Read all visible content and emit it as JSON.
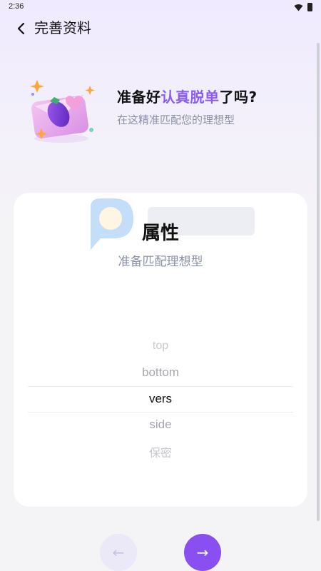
{
  "status": {
    "time": "2:36"
  },
  "header": {
    "title": "完善资料"
  },
  "hero": {
    "title_before": "准备好",
    "title_accent": "认真脱单",
    "title_after": "了吗?",
    "subtitle": "在这精准匹配您的理想型"
  },
  "card": {
    "title": "属性",
    "subtitle": "准备匹配理想型",
    "options": [
      "top",
      "bottom",
      "vers",
      "side",
      "保密"
    ],
    "selected": "vers"
  },
  "nav": {
    "prev_label": "←",
    "next_label": "→"
  },
  "colors": {
    "accent": "#8a5cf5",
    "button": "#8a4ff0",
    "watermark": "#4a90e2"
  }
}
